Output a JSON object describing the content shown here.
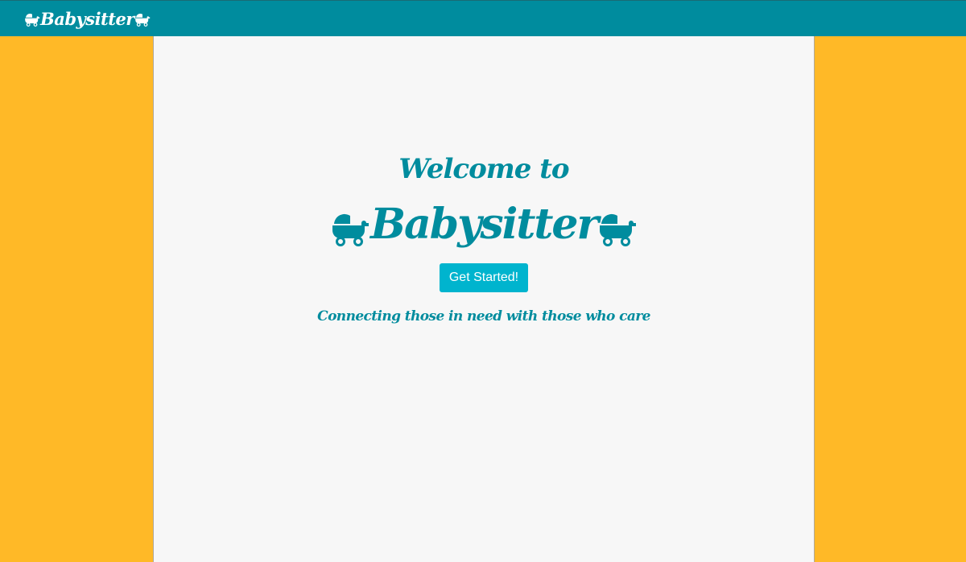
{
  "navbar": {
    "brand": "Babysitter",
    "background": "#008C9E"
  },
  "hero": {
    "welcome": "Welcome to",
    "brand": "Babysitter",
    "cta_label": "Get Started!",
    "tagline": "Connecting those in need with those who care"
  },
  "icons": {
    "brand_left": "baby-carriage-icon",
    "brand_right": "baby-carriage-icon"
  },
  "colors": {
    "accent": "#008C9E",
    "button": "#00B4CE",
    "side_background": "#FFB927",
    "panel_background": "#F7F7F7"
  }
}
